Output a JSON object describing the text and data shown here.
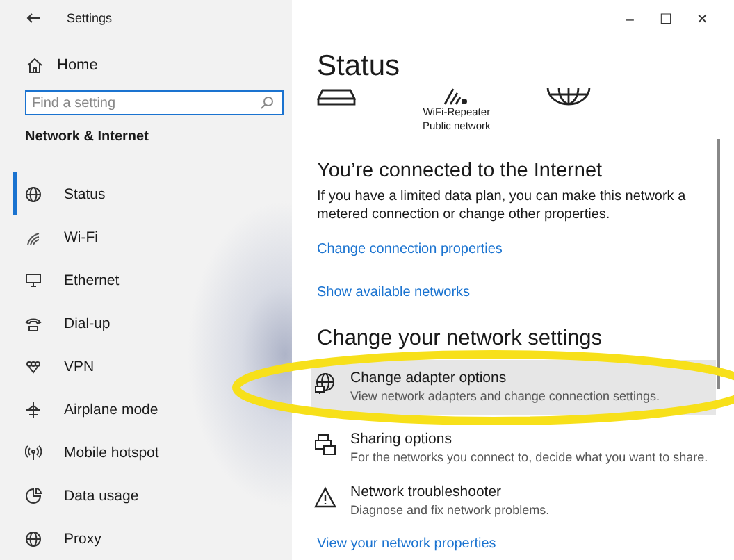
{
  "window": {
    "title": "Settings",
    "controls": [
      "–",
      "☐",
      "✕"
    ]
  },
  "sidebar": {
    "home": "Home",
    "search": {
      "placeholder": "Find a setting"
    },
    "section": "Network & Internet",
    "items": [
      {
        "label": "Status",
        "selected": true
      },
      {
        "label": "Wi-Fi",
        "selected": false
      },
      {
        "label": "Ethernet",
        "selected": false
      },
      {
        "label": "Dial-up",
        "selected": false
      },
      {
        "label": "VPN",
        "selected": false
      },
      {
        "label": "Airplane mode",
        "selected": false
      },
      {
        "label": "Mobile hotspot",
        "selected": false
      },
      {
        "label": "Data usage",
        "selected": false
      },
      {
        "label": "Proxy",
        "selected": false
      }
    ]
  },
  "main": {
    "title": "Status",
    "network": {
      "name": "WiFi-Repeater",
      "type": "Public network"
    },
    "connection": {
      "heading": "You’re connected to the Internet",
      "text": "If you have a limited data plan, you can make this network a metered connection or change other properties."
    },
    "links": [
      "Change connection properties",
      "Show available networks"
    ],
    "settings_heading": "Change your network settings",
    "options": [
      {
        "title": "Change adapter options",
        "description": "View network adapters and change connection settings.",
        "selected": true
      },
      {
        "title": "Sharing options",
        "description": "For the networks you connect to, decide what you want to share.",
        "selected": false
      },
      {
        "title": "Network troubleshooter",
        "description": "Diagnose and fix network problems.",
        "selected": false
      }
    ],
    "bottom_link": "View your network properties"
  },
  "highlight": {
    "kind": "ellipse"
  }
}
